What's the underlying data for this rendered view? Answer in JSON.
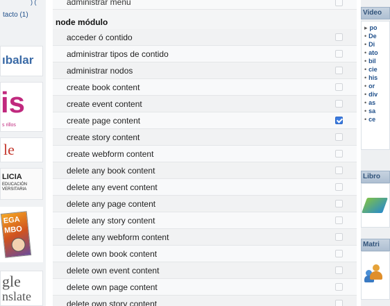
{
  "left_sidebar": {
    "contact_top": ") (",
    "contact_label": "tacto (1)",
    "logos": {
      "logo1": "ıbalar",
      "logo2_big": "is",
      "logo2_small": "s rillos",
      "logo3": "le",
      "logo4_title": "LICIA",
      "logo4_line1": "EDUCACIÓN",
      "logo4_line2": "VERSITARIA",
      "logo5_line1": "EGA",
      "logo5_line2": "MBO",
      "logo6_line1": "gle",
      "logo6_line2": "nslate"
    }
  },
  "permissions": {
    "partial_top_label": "administrar menu",
    "section_title": "node módulo",
    "rows": [
      {
        "label": "acceder ó contido",
        "checked": false
      },
      {
        "label": "administrar tipos de contido",
        "checked": false
      },
      {
        "label": "administrar nodos",
        "checked": false
      },
      {
        "label": "create book content",
        "checked": false
      },
      {
        "label": "create event content",
        "checked": false
      },
      {
        "label": "create page content",
        "checked": true
      },
      {
        "label": "create story content",
        "checked": false
      },
      {
        "label": "create webform content",
        "checked": false
      },
      {
        "label": "delete any book content",
        "checked": false
      },
      {
        "label": "delete any event content",
        "checked": false
      },
      {
        "label": "delete any page content",
        "checked": false
      },
      {
        "label": "delete any story content",
        "checked": false
      },
      {
        "label": "delete any webform content",
        "checked": false
      },
      {
        "label": "delete own book content",
        "checked": false
      },
      {
        "label": "delete own event content",
        "checked": false
      },
      {
        "label": "delete own page content",
        "checked": false
      },
      {
        "label": "delete own story content",
        "checked": false
      }
    ]
  },
  "right_sidebar": {
    "videos_title": "Video",
    "video_items": [
      "po",
      "De",
      "Di",
      "ato",
      "bil",
      "cie",
      "his",
      "or",
      "div",
      "as",
      "sa",
      "ce"
    ],
    "books_title": "Libro",
    "matrix_title": "Matri"
  },
  "colors": {
    "checkbox_checked": "#3b7be0",
    "link": "#1f4f8a",
    "block_header": "#aebfd2"
  }
}
